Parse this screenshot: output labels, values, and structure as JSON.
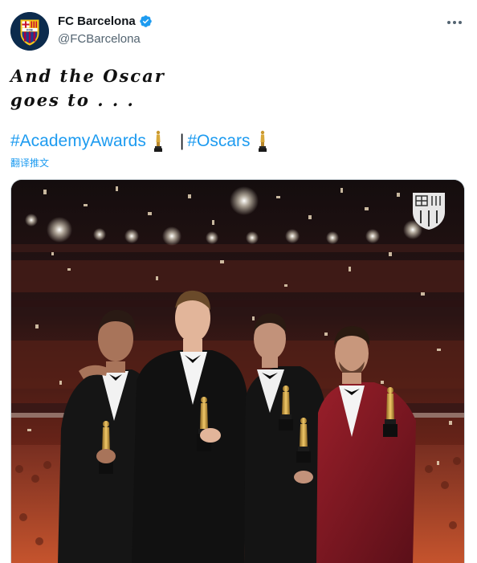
{
  "author": {
    "display_name": "FC Barcelona",
    "handle": "@FCBarcelona",
    "verified": true,
    "crest_letters": "FCB"
  },
  "tweet": {
    "line1": "And the Oscar",
    "line2": "goes to . . .",
    "hashtag1": "#AcademyAwards",
    "separator": "|",
    "hashtag2": "#Oscars",
    "translate_label": "翻译推文"
  },
  "colors": {
    "link": "#1d9bf0",
    "secondary_text": "#536471",
    "verified": "#1d9bf0"
  },
  "icons": {
    "more": "more-horizontal-icon",
    "oscar": "oscar-statuette-icon",
    "verified": "verified-badge-icon"
  }
}
